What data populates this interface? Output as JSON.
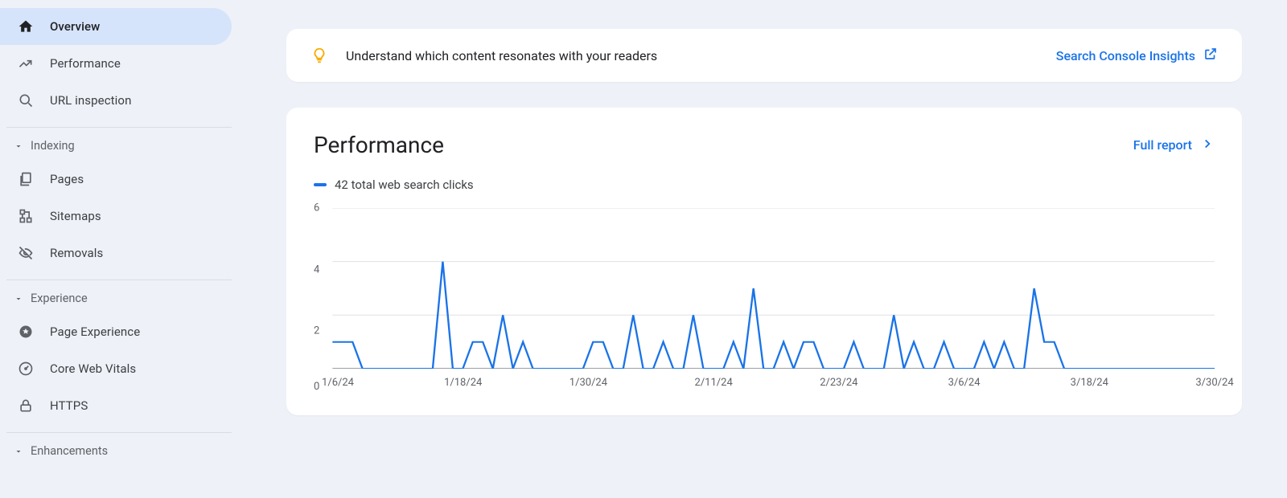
{
  "sidebar": {
    "top_items": [
      {
        "label": "Overview",
        "icon": "home",
        "active": true
      },
      {
        "label": "Performance",
        "icon": "trend",
        "active": false
      },
      {
        "label": "URL inspection",
        "icon": "search",
        "active": false
      }
    ],
    "sections": [
      {
        "title": "Indexing",
        "expanded": true,
        "items": [
          {
            "label": "Pages",
            "icon": "pages"
          },
          {
            "label": "Sitemaps",
            "icon": "sitemap"
          },
          {
            "label": "Removals",
            "icon": "eye-off"
          }
        ]
      },
      {
        "title": "Experience",
        "expanded": true,
        "items": [
          {
            "label": "Page Experience",
            "icon": "badge"
          },
          {
            "label": "Core Web Vitals",
            "icon": "gauge"
          },
          {
            "label": "HTTPS",
            "icon": "lock"
          }
        ]
      },
      {
        "title": "Enhancements",
        "expanded": true,
        "items": []
      }
    ]
  },
  "insights_banner": {
    "text": "Understand which content resonates with your readers",
    "link_label": "Search Console Insights"
  },
  "performance": {
    "title": "Performance",
    "full_report_label": "Full report",
    "legend_label": "42 total web search clicks"
  },
  "chart_data": {
    "type": "line",
    "title": "Performance",
    "xlabel": "",
    "ylabel": "",
    "ylim": [
      0,
      6
    ],
    "y_ticks": [
      0,
      2,
      4,
      6
    ],
    "x_tick_labels": [
      "1/6/24",
      "1/18/24",
      "1/30/24",
      "2/11/24",
      "2/23/24",
      "3/6/24",
      "3/18/24",
      "3/30/24"
    ],
    "series": [
      {
        "name": "42 total web search clicks",
        "color": "#1a73e8",
        "values": [
          1,
          1,
          1,
          0,
          0,
          0,
          0,
          0,
          0,
          0,
          0,
          4,
          0,
          0,
          1,
          1,
          0,
          2,
          0,
          1,
          0,
          0,
          0,
          0,
          0,
          0,
          1,
          1,
          0,
          0,
          2,
          0,
          0,
          1,
          0,
          0,
          2,
          0,
          0,
          0,
          1,
          0,
          3,
          0,
          0,
          1,
          0,
          1,
          1,
          0,
          0,
          0,
          1,
          0,
          0,
          0,
          2,
          0,
          1,
          0,
          0,
          1,
          0,
          0,
          0,
          1,
          0,
          1,
          0,
          0,
          3,
          1,
          1,
          0,
          0,
          0,
          0,
          0,
          0,
          0,
          0,
          0,
          0,
          0,
          0,
          0,
          0,
          0,
          0
        ]
      }
    ]
  }
}
